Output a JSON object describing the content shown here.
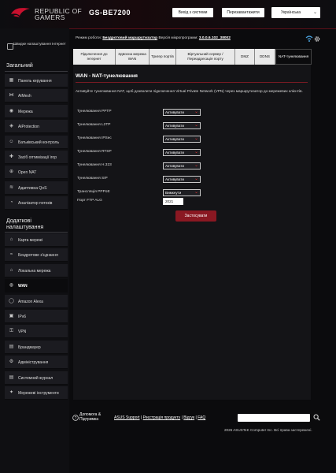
{
  "header": {
    "brand_line1": "REPUBLIC OF",
    "brand_line2": "GAMERS",
    "model": "GS-BE7200",
    "logout": "Вихід з системи",
    "reboot": "Перезавантажити",
    "language": "Українська"
  },
  "sidebar": {
    "quick_setup": "Швидке налаштування Інтернет",
    "general_title": "Загальний",
    "general_items": [
      {
        "label": "Панель керування",
        "icon": "dashboard-icon"
      },
      {
        "label": "AiMesh",
        "icon": "mesh-icon"
      },
      {
        "label": "Мережа",
        "icon": "network-icon"
      },
      {
        "label": "AiProtection",
        "icon": "shield-icon"
      },
      {
        "label": "Батьківський контроль",
        "icon": "parental-icon"
      },
      {
        "label": "Засіб оптимізації ігор",
        "icon": "gamepad-icon"
      },
      {
        "label": "Open NAT",
        "icon": "open-nat-icon"
      },
      {
        "label": "Адаптивна QoS",
        "icon": "qos-icon"
      },
      {
        "label": "Аналізатор потоків",
        "icon": "analyzer-icon"
      }
    ],
    "advanced_title_1": "Додаткові",
    "advanced_title_2": "налаштування",
    "advanced_items": [
      {
        "label": "Карта мережі",
        "icon": "map-icon"
      },
      {
        "label": "Бездротове з'єднання",
        "icon": "wireless-icon"
      },
      {
        "label": "Локальна мережа",
        "icon": "lan-icon"
      },
      {
        "label": "WAN",
        "icon": "globe-icon"
      },
      {
        "label": "Amazon Alexa",
        "icon": "alexa-icon"
      },
      {
        "label": "IPv6",
        "icon": "ipv6-icon"
      },
      {
        "label": "VPN",
        "icon": "vpn-icon"
      },
      {
        "label": "Брандмауер",
        "icon": "firewall-icon"
      },
      {
        "label": "Адміністрування",
        "icon": "admin-icon"
      },
      {
        "label": "Системний журнал",
        "icon": "log-icon"
      },
      {
        "label": "Мережеві інструменти",
        "icon": "tools-icon"
      }
    ]
  },
  "info": {
    "mode_label": "Режим роботи:",
    "mode_value": "Бездротовий маршрутизатор",
    "fw_label": "Версія мікропрограми:",
    "fw_value": "3.0.0.6.102_38002"
  },
  "tabs": [
    "Підключення до Інтернет",
    "Здвоєна мережа WAN",
    "Тригер портів",
    "Віртуальний сервер / Переадресація порту",
    "DMZ",
    "DDNS",
    "NAT-тунелювання"
  ],
  "panel": {
    "title": "WAN - NAT-тунелювання",
    "description": "Активуйте тунелювання NAT, щоб дозволити підключення Virtual Private Network (VPN) через маршрутизатор до мережевих клієнтів.",
    "fields": [
      {
        "label": "Тунелювання PPTP",
        "value": "Активувати"
      },
      {
        "label": "Тунелювання L2TP",
        "value": "Активувати"
      },
      {
        "label": "Тунелювання IPSec",
        "value": "Активувати"
      },
      {
        "label": "Тунелювання RTSP",
        "value": "Активувати"
      },
      {
        "label": "Тунелювання H.323",
        "value": "Активувати"
      },
      {
        "label": "Тунелювання SIP",
        "value": "Активувати"
      },
      {
        "label": "Трансляція PPPoE",
        "value": "Вимкнути"
      }
    ],
    "ftp_label": "Порт FTP ALG",
    "ftp_value": "2021",
    "apply": "Застосувати"
  },
  "footer": {
    "help": "Допомога & Підтримка",
    "asus_support": "ASUS Support",
    "register": "Реєстрація продукту",
    "feedback": "Відгук",
    "faq": "FAQ",
    "sep": "|",
    "copyright": "2026 ASUSTeK Computer Inc. Всі права застережені."
  },
  "colors": {
    "accent": "#8a1822",
    "background": "#0b0b0d",
    "panel": "#141417"
  }
}
